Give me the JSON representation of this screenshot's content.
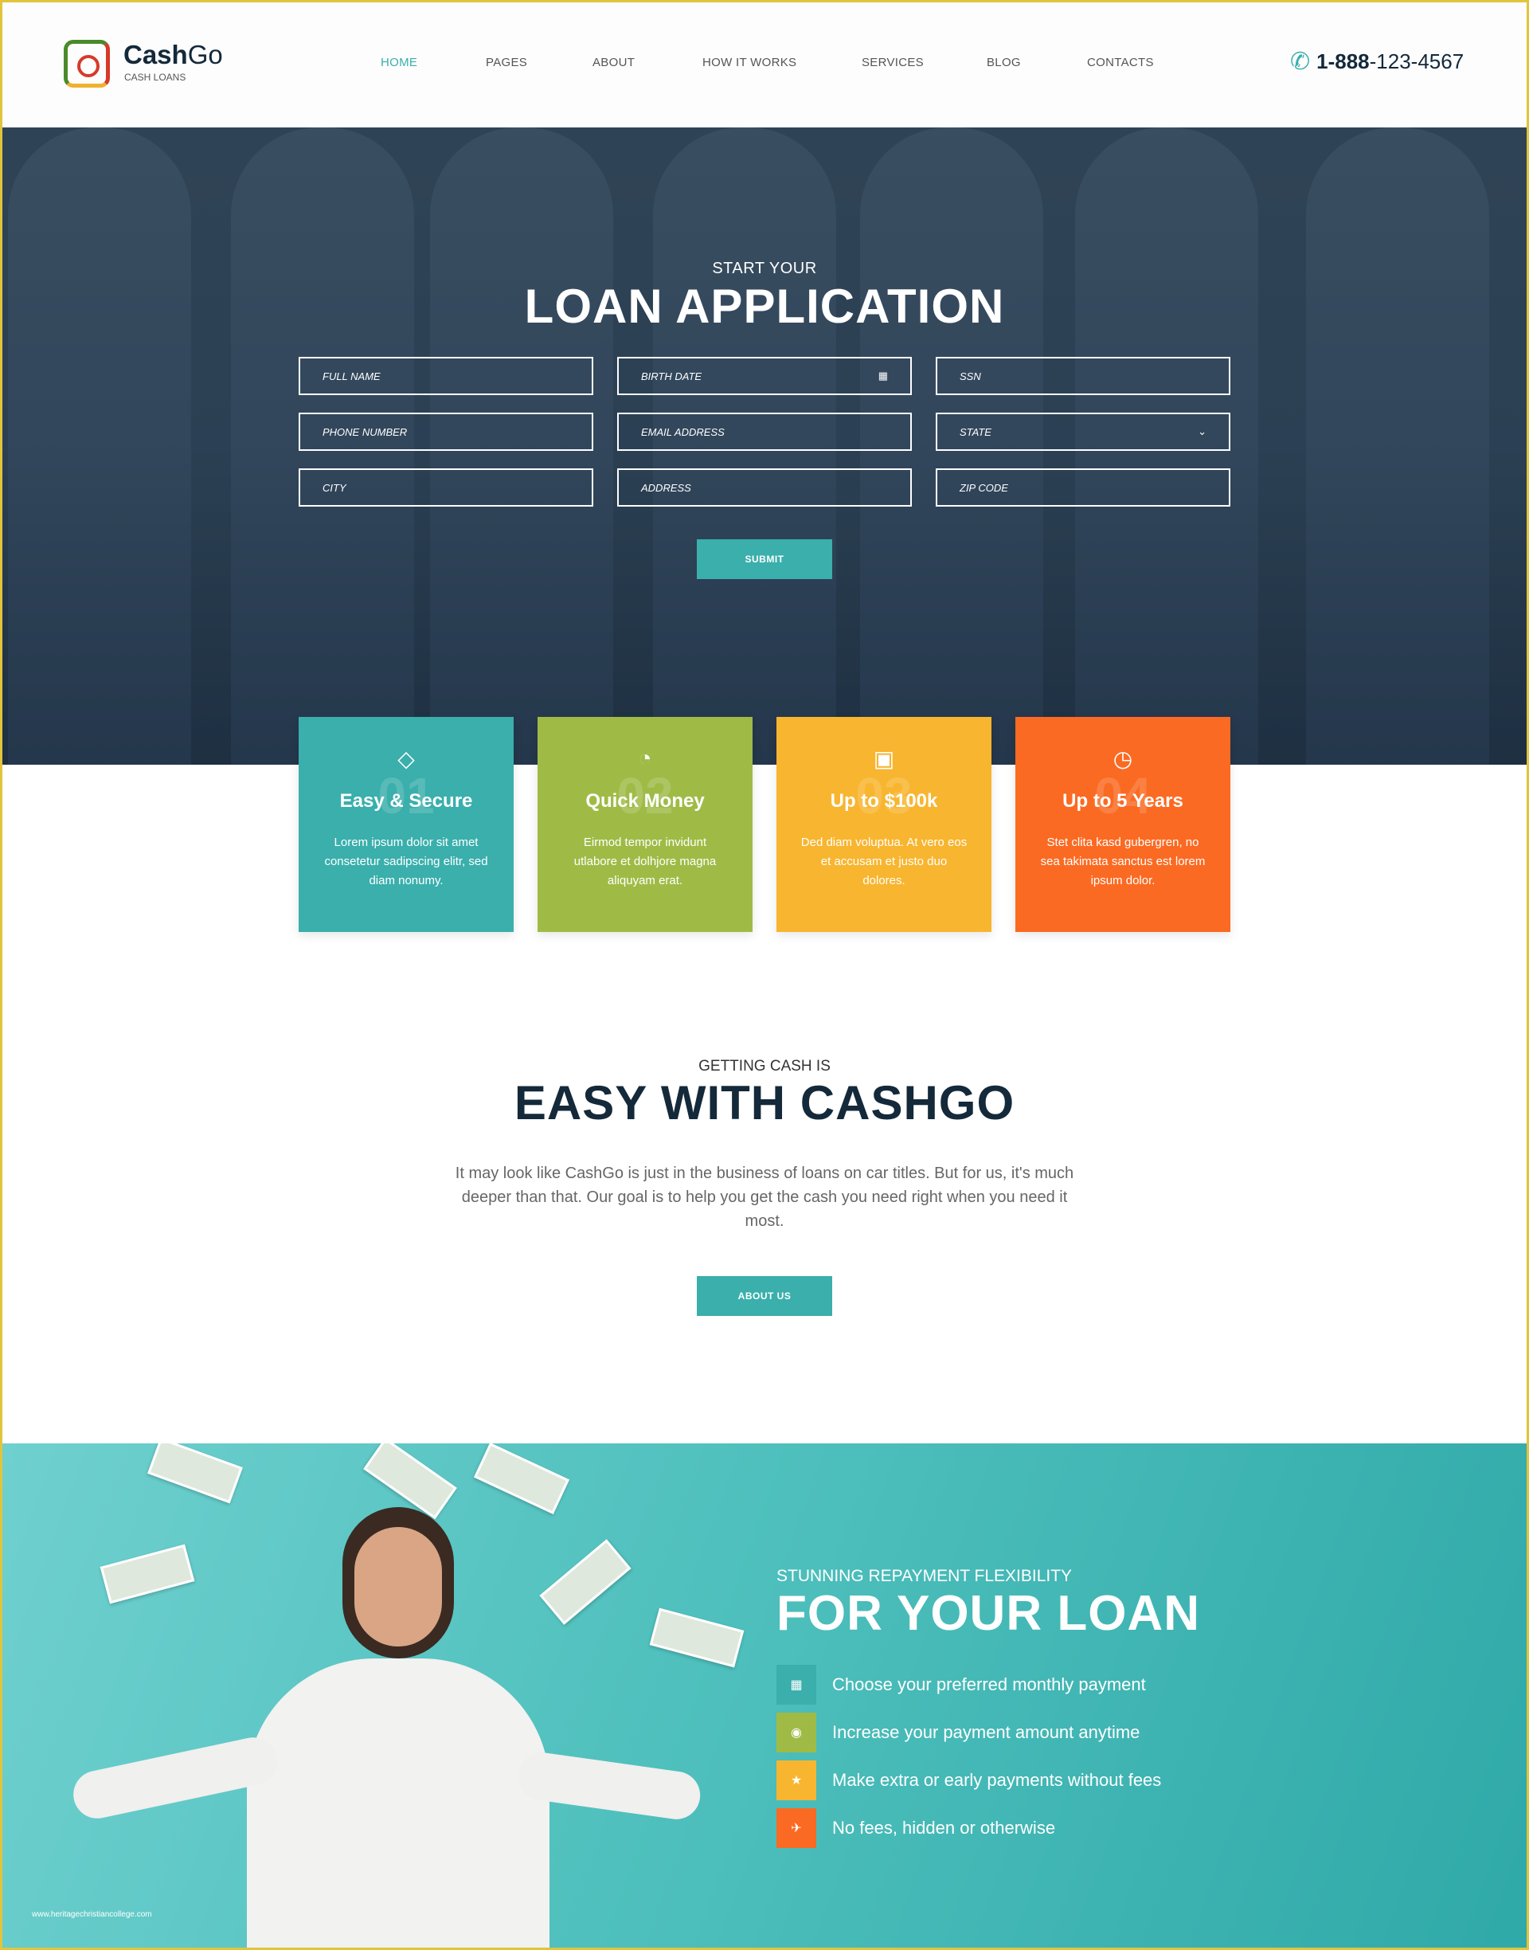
{
  "header": {
    "brand_bold": "Cash",
    "brand_light": "Go",
    "tagline": "CASH LOANS",
    "nav": [
      {
        "label": "HOME",
        "active": true
      },
      {
        "label": "PAGES"
      },
      {
        "label": "ABOUT"
      },
      {
        "label": "HOW IT WORKS"
      },
      {
        "label": "SERVICES"
      },
      {
        "label": "BLOG"
      },
      {
        "label": "CONTACTS"
      }
    ],
    "phone_bold": "1-888",
    "phone_rest": "-123-4567"
  },
  "hero": {
    "kicker": "START YOUR",
    "title": "LOAN APPLICATION",
    "fields": [
      {
        "placeholder": "FULL NAME"
      },
      {
        "placeholder": "BIRTH DATE",
        "icon": "calendar-icon"
      },
      {
        "placeholder": "SSN"
      },
      {
        "placeholder": "PHONE NUMBER"
      },
      {
        "placeholder": "EMAIL ADDRESS"
      },
      {
        "placeholder": "STATE",
        "icon": "chevron-down-icon"
      },
      {
        "placeholder": "CITY"
      },
      {
        "placeholder": "ADDRESS"
      },
      {
        "placeholder": "ZIP CODE"
      }
    ],
    "submit": "SUBMIT"
  },
  "features": [
    {
      "num": "01",
      "title": "Easy & Secure",
      "text": "Lorem ipsum dolor sit amet consetetur sadipscing elitr, sed diam nonumy.",
      "color": "#3aafac",
      "icon": "diamond-icon"
    },
    {
      "num": "02",
      "title": "Quick Money",
      "text": "Eirmod tempor invidunt utlabore et dolhjore magna aliquyam erat.",
      "color": "#9fbb46",
      "icon": "speedometer-icon"
    },
    {
      "num": "03",
      "title": "Up to $100k",
      "text": "Ded diam voluptua. At vero eos et accusam et justo duo dolores.",
      "color": "#f8b52f",
      "icon": "money-bill-icon"
    },
    {
      "num": "04",
      "title": "Up to 5 Years",
      "text": "Stet clita kasd gubergren, no sea takimata sanctus est lorem ipsum dolor.",
      "color": "#fb6a22",
      "icon": "clock-icon"
    }
  ],
  "about": {
    "kicker": "GETTING CASH IS",
    "title": "EASY WITH CASHGO",
    "text": "It may look like CashGo is just in the business of loans on car titles. But for us, it's much deeper than that. Our goal is to help you get the cash you need right when you need it most.",
    "button": "ABOUT US"
  },
  "flex": {
    "kicker": "STUNNING REPAYMENT FLEXIBILITY",
    "title": "FOR YOUR LOAN",
    "items": [
      {
        "text": "Choose your preferred monthly payment",
        "color": "#3aafac",
        "icon": "calendar-icon"
      },
      {
        "text": "Increase your payment amount anytime",
        "color": "#9fbb46",
        "icon": "target-icon"
      },
      {
        "text": "Make extra or early payments without fees",
        "color": "#f8b52f",
        "icon": "star-icon"
      },
      {
        "text": "No fees, hidden or otherwise",
        "color": "#fb6a22",
        "icon": "plane-icon"
      }
    ]
  },
  "watermark": "www.heritagechristiancollege.com"
}
